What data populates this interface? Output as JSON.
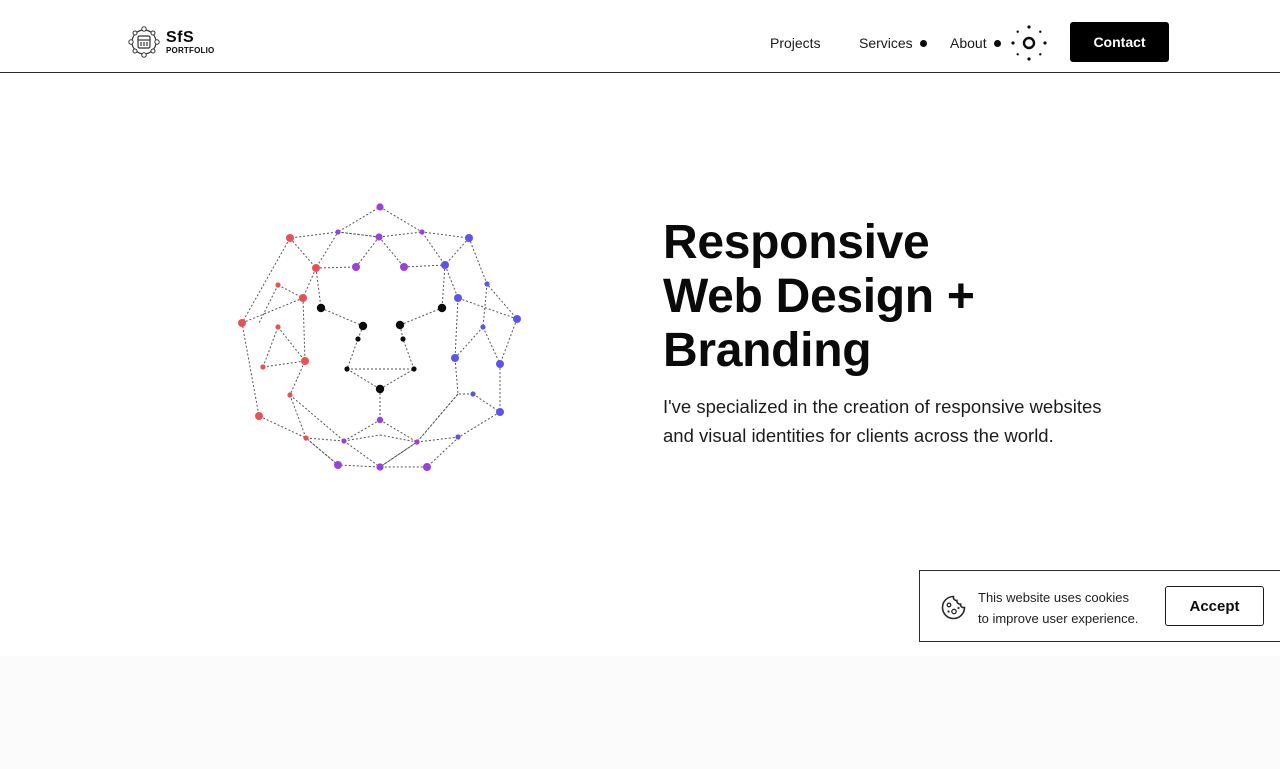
{
  "header": {
    "logo": {
      "mark": "SfS",
      "subtitle": "PORTFOLIO"
    },
    "nav": [
      {
        "label": "Projects",
        "has_dot": false
      },
      {
        "label": "Services",
        "has_dot": true
      },
      {
        "label": "About",
        "has_dot": true
      }
    ],
    "theme_toggle_icon": "sun-icon",
    "contact_label": "Contact"
  },
  "hero": {
    "title_lines": [
      "Responsive",
      "Web Design +",
      "Branding"
    ],
    "subtitle_lines": [
      "I've specialized in the creation of responsive websites",
      "and visual identities for clients across the world."
    ],
    "graphic": {
      "icon": "lion-face-network-icon",
      "colors": {
        "left": "#ea5055",
        "top": "#9b3fe0",
        "right": "#5a55ec",
        "center": "#0b0b0b",
        "link": "#555555"
      }
    }
  },
  "cookie_banner": {
    "icon": "cookie-icon",
    "text_lines": [
      "This website uses cookies",
      "to improve user experience."
    ],
    "accept_label": "Accept"
  },
  "colors": {
    "accent": "#000000",
    "text": "#0b0b0b",
    "background": "#ffffff",
    "footer_band": "#fbfbfc"
  }
}
